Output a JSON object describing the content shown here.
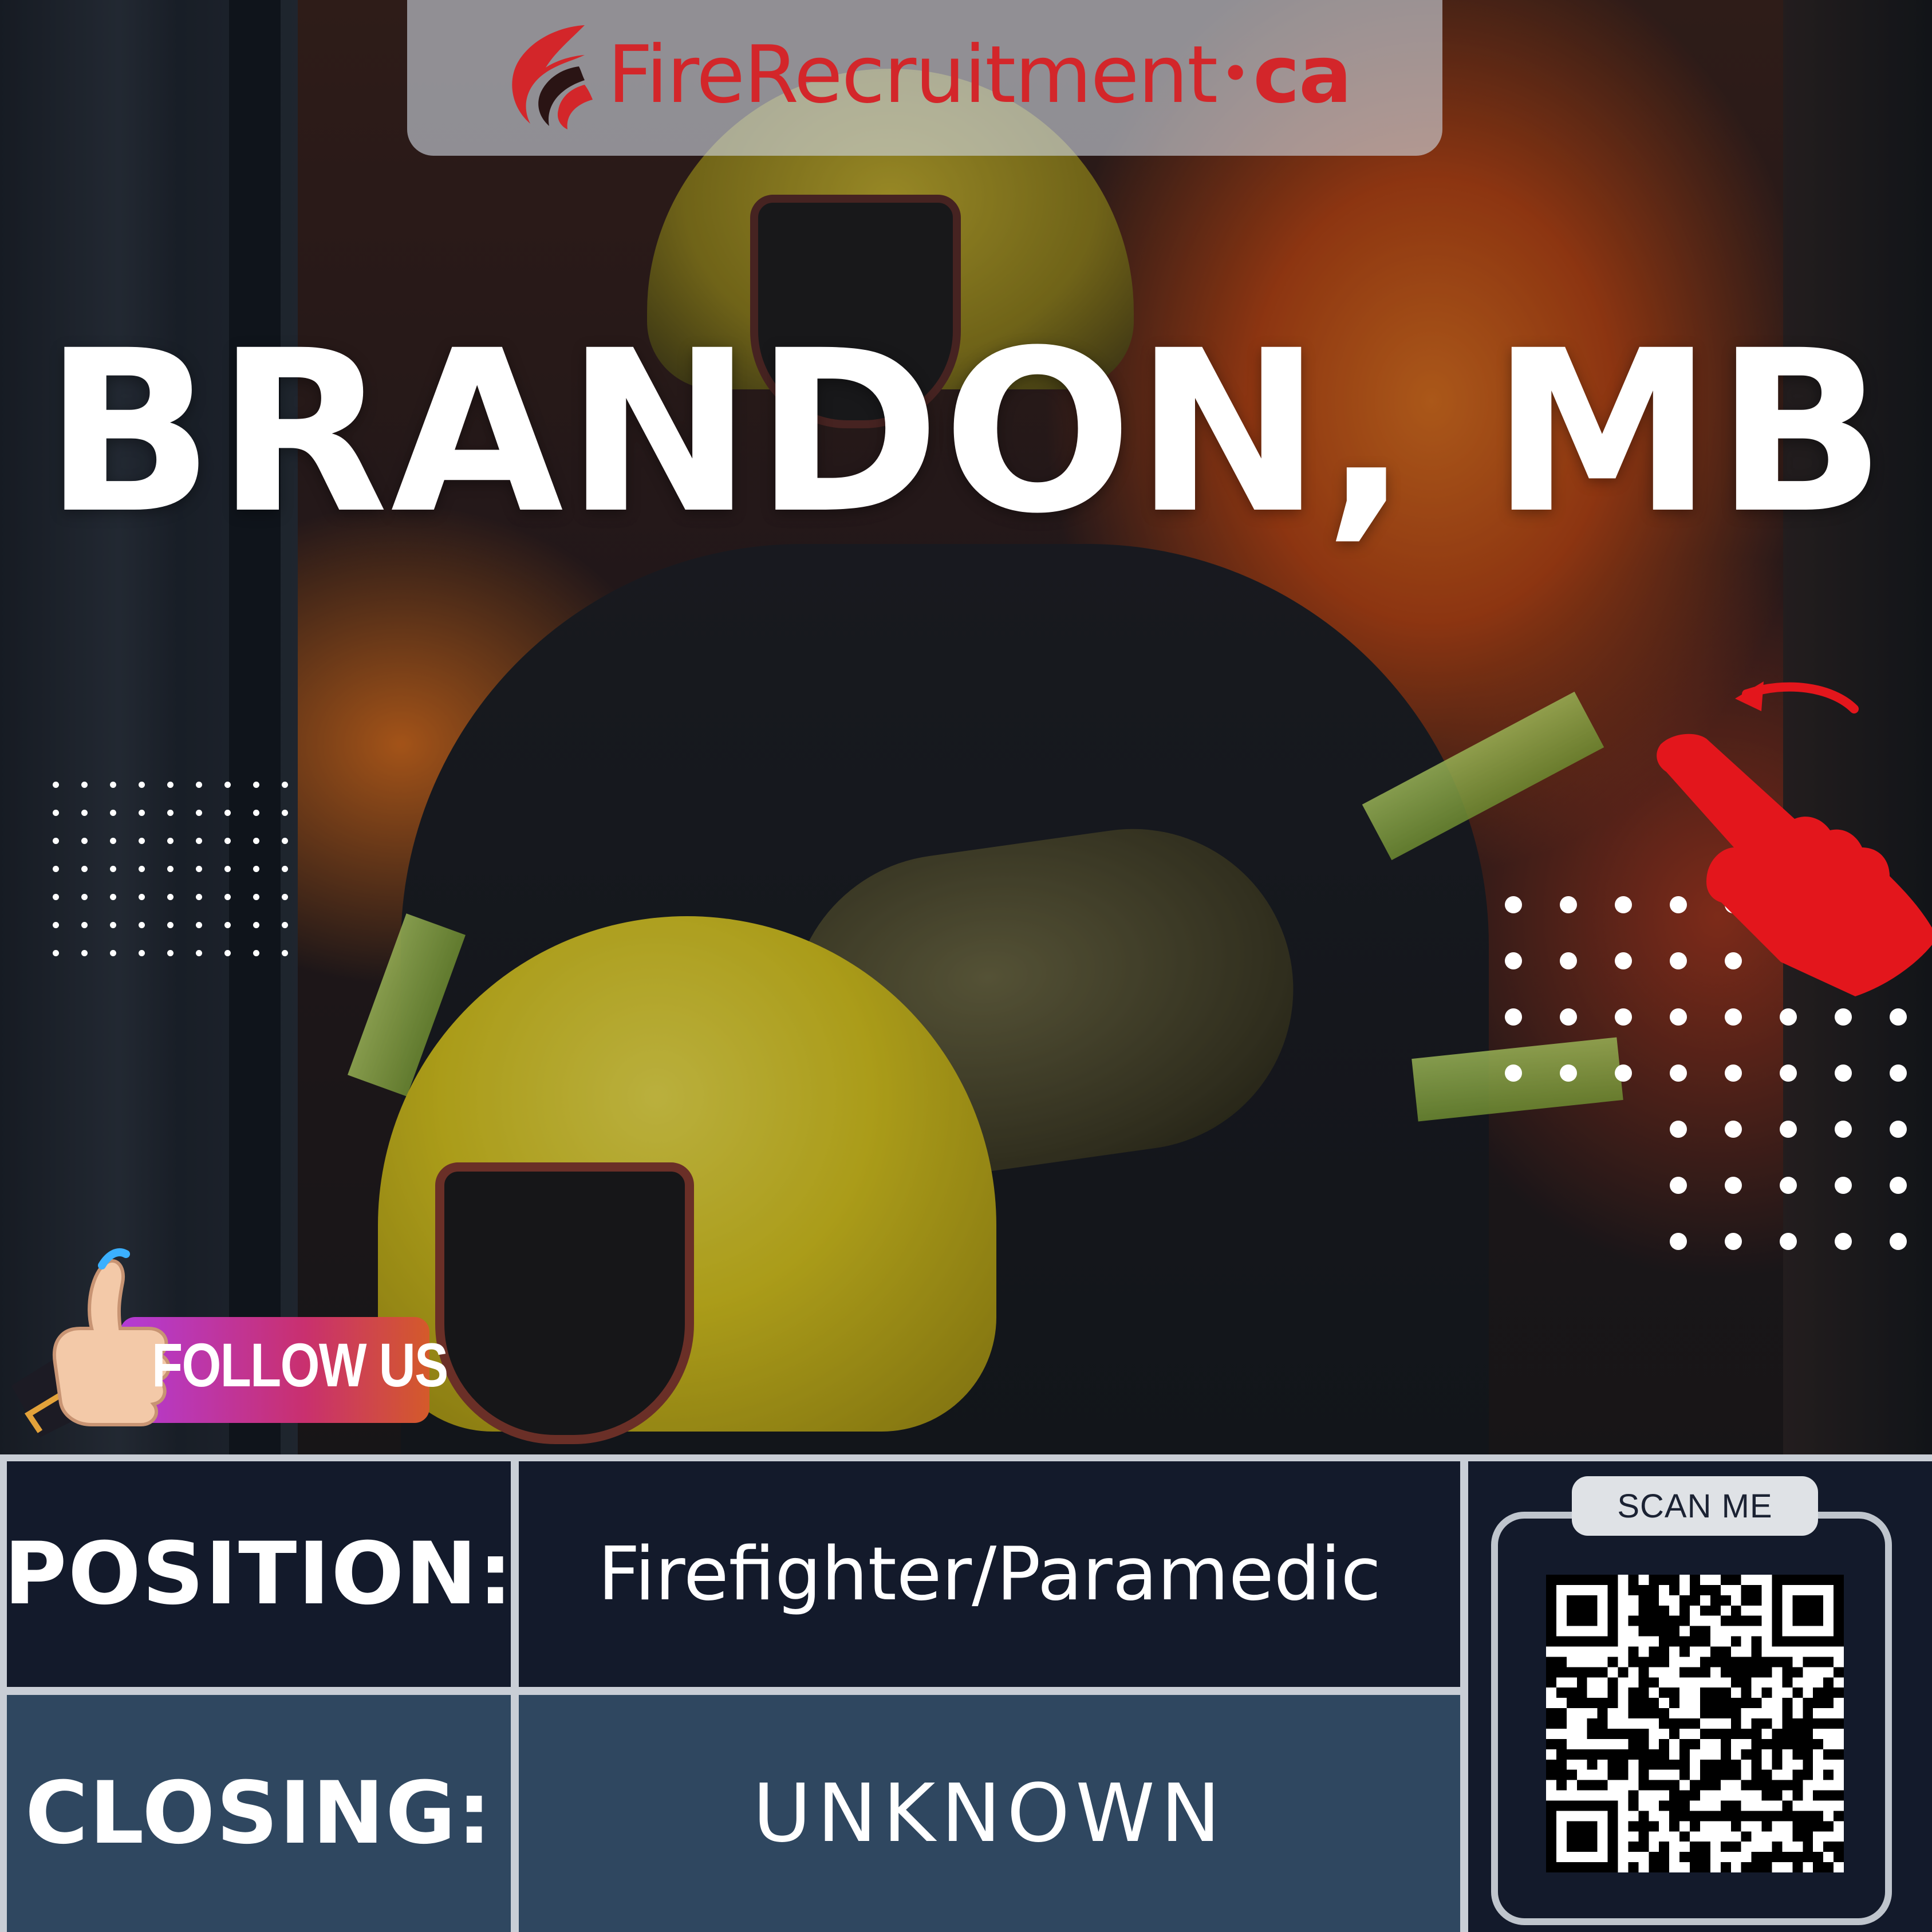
{
  "logo": {
    "text_main": "FireRecruitment",
    "text_dot": "•",
    "text_tld": "ca",
    "brand_color": "#d3262a",
    "icon": "flame-logo-icon"
  },
  "headline": "BRANDON, MB",
  "follow_badge": {
    "label": "FOLLOW US",
    "icon": "thumbs-up-icon"
  },
  "pointer_icon": "pointing-hand-icon",
  "details": {
    "position_label": "POSITION:",
    "position_value": "Firefighter/Paramedic",
    "closing_label": "CLOSING:",
    "closing_value": "UNKNOWN"
  },
  "qr": {
    "tab_label": "SCAN ME",
    "icon": "qr-code-icon"
  },
  "colors": {
    "navy": "#131a2b",
    "slate": "#2f4760",
    "accent_red": "#e3161c"
  }
}
